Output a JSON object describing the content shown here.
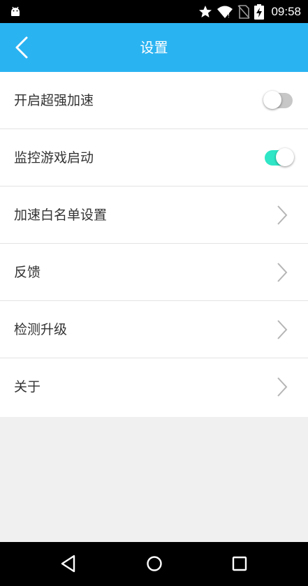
{
  "status_bar": {
    "time": "09:58",
    "icons": [
      "android-icon",
      "star-icon",
      "wifi-icon",
      "no-sim-icon",
      "battery-charging-icon"
    ]
  },
  "toolbar": {
    "title": "设置",
    "back_icon": "back-chevron-icon",
    "color": "#2ab3f1"
  },
  "settings": {
    "items": [
      {
        "label": "开启超强加速",
        "control": "toggle",
        "on": false
      },
      {
        "label": "监控游戏启动",
        "control": "toggle",
        "on": true
      },
      {
        "label": "加速白名单设置",
        "control": "chevron"
      },
      {
        "label": "反馈",
        "control": "chevron"
      },
      {
        "label": "检测升级",
        "control": "chevron"
      },
      {
        "label": "关于",
        "control": "chevron"
      }
    ],
    "toggle_on_color": "#2fe6c6"
  },
  "nav_bar": {
    "icons": [
      "back-triangle-icon",
      "home-circle-icon",
      "recents-square-icon"
    ]
  }
}
